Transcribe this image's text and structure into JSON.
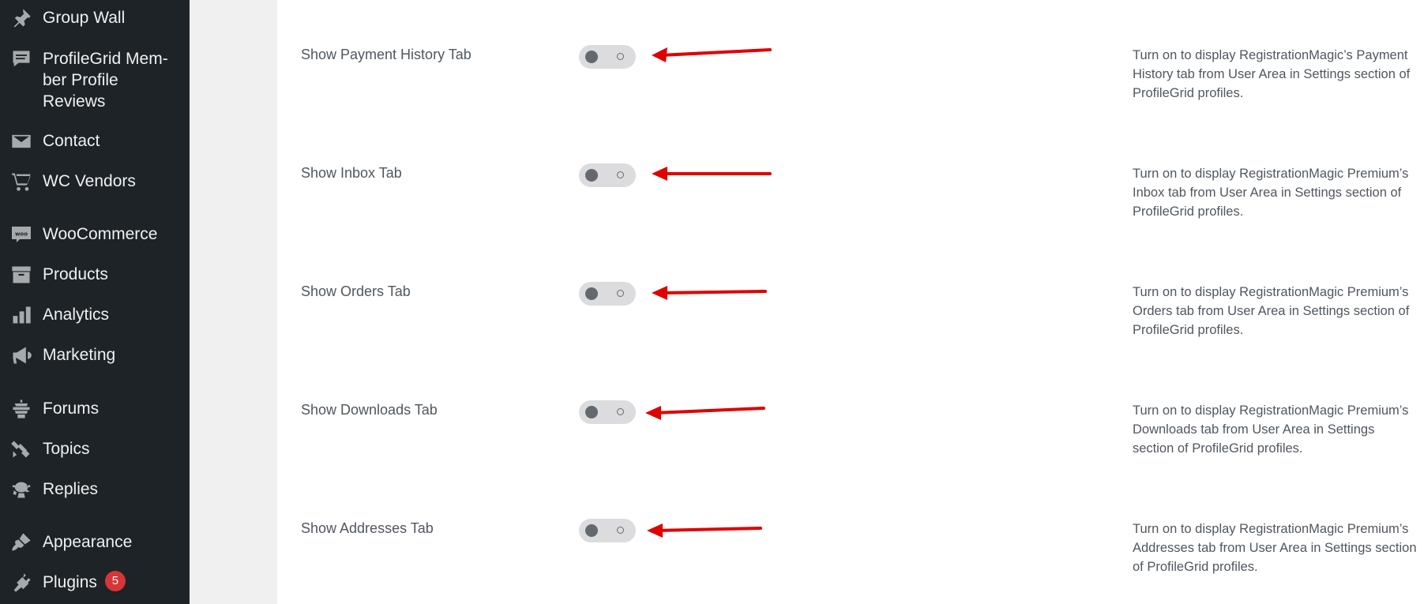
{
  "sidebar": {
    "items": [
      {
        "label": "Group Wall",
        "icon": "pin-icon"
      },
      {
        "label": "ProfileGrid Member Profile Reviews",
        "display": "ProfileGrid Mem-\nber Profile\nReviews",
        "icon": "comment-icon"
      },
      {
        "label": "Contact",
        "icon": "envelope-icon"
      },
      {
        "label": "WC Vendors",
        "icon": "cart-icon"
      },
      {
        "label": "WooCommerce",
        "icon": "woo-icon"
      },
      {
        "label": "Products",
        "icon": "archive-icon"
      },
      {
        "label": "Analytics",
        "icon": "bar-chart-icon"
      },
      {
        "label": "Marketing",
        "icon": "megaphone-icon"
      },
      {
        "label": "Forums",
        "icon": "forums-icon"
      },
      {
        "label": "Topics",
        "icon": "topics-icon"
      },
      {
        "label": "Replies",
        "icon": "replies-icon"
      },
      {
        "label": "Appearance",
        "icon": "paintbrush-icon"
      },
      {
        "label": "Plugins",
        "icon": "plug-icon",
        "badge": "5"
      }
    ]
  },
  "settings": [
    {
      "label": "Show Payment History Tab",
      "enabled": false,
      "description": "Turn on to display RegistrationMagic’s Payment History tab from User Area in Settings section of ProfileGrid profiles."
    },
    {
      "label": "Show Inbox Tab",
      "enabled": false,
      "description": "Turn on to display RegistrationMagic Premium’s Inbox tab from User Area in Settings section of ProfileGrid profiles."
    },
    {
      "label": "Show Orders Tab",
      "enabled": false,
      "description": "Turn on to display RegistrationMagic Premium’s Orders tab from User Area in Settings section of ProfileGrid profiles."
    },
    {
      "label": "Show Downloads Tab",
      "enabled": false,
      "description": "Turn on to display RegistrationMagic Premium’s Downloads tab from User Area in Settings section of ProfileGrid profiles."
    },
    {
      "label": "Show Addresses Tab",
      "enabled": false,
      "description": "Turn on to display RegistrationMagic Premium’s Addresses tab from User Area in Settings section of ProfileGrid profiles."
    }
  ],
  "colors": {
    "sidebar_bg": "#1d2327",
    "annotation_arrow": "#e00000",
    "badge": "#d63638"
  }
}
